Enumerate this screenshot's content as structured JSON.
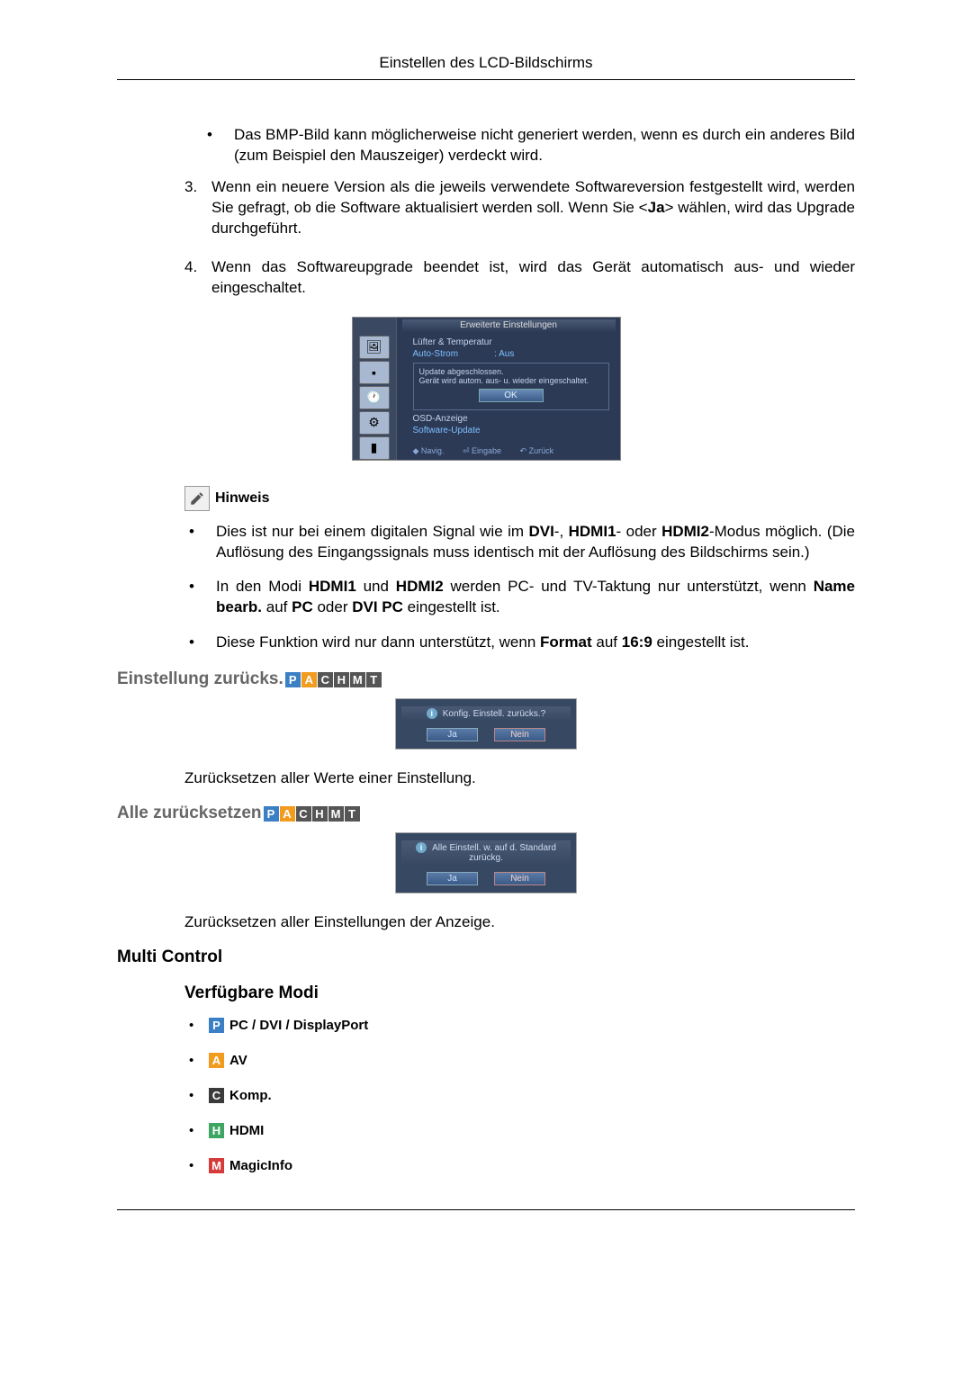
{
  "header": {
    "title": "Einstellen des LCD-Bildschirms"
  },
  "top_bullets": [
    "Das BMP-Bild kann möglicherweise nicht generiert werden, wenn es durch ein anderes Bild (zum Beispiel den Mauszeiger) verdeckt wird."
  ],
  "numbered": [
    {
      "n": "3.",
      "text_pre": "Wenn ein neuere Version als die jeweils verwendete Softwareversion festgestellt wird, werden Sie gefragt, ob die Software aktualisiert werden soll. Wenn Sie <",
      "bold": "Ja",
      "text_post": "> wählen, wird das Upgrade durchgeführt."
    },
    {
      "n": "4.",
      "text_pre": "Wenn das Softwareupgrade beendet ist, wird das Gerät automatisch aus- und wieder eingeschaltet.",
      "bold": "",
      "text_post": ""
    }
  ],
  "osd": {
    "title": "Erweiterte Einstellungen",
    "row1": "Lüfter & Temperatur",
    "row2_label": "Auto-Strom",
    "row2_value": ": Aus",
    "msg1": "Update abgeschlossen.",
    "msg2": "Gerät wird autom. aus- u. wieder eingeschaltet.",
    "ok": "OK",
    "row3": "OSD-Anzeige",
    "row4": "Software-Update",
    "footer_nav": "◆ Navig.",
    "footer_enter": "⏎ Eingabe",
    "footer_back": "↶ Zurück"
  },
  "hinweis": {
    "label": "Hinweis",
    "items": [
      {
        "parts": [
          {
            "t": "Dies ist nur bei einem digitalen Signal wie im "
          },
          {
            "b": "DVI"
          },
          {
            "t": "-, "
          },
          {
            "b": "HDMI1"
          },
          {
            "t": "- oder "
          },
          {
            "b": "HDMI2"
          },
          {
            "t": "-Modus möglich. (Die Auflösung des Eingangssignals muss identisch mit der Auflösung des Bildschirms sein.)"
          }
        ]
      },
      {
        "parts": [
          {
            "t": "In den Modi "
          },
          {
            "b": "HDMI1"
          },
          {
            "t": " und "
          },
          {
            "b": "HDMI2"
          },
          {
            "t": " werden PC- und TV-Taktung nur unterstützt, wenn "
          },
          {
            "b": "Name bearb."
          },
          {
            "t": " auf "
          },
          {
            "b": "PC"
          },
          {
            "t": " oder "
          },
          {
            "b": "DVI PC"
          },
          {
            "t": " eingestellt ist."
          }
        ]
      },
      {
        "parts": [
          {
            "t": "Diese Funktion wird nur dann unterstützt, wenn "
          },
          {
            "b": "Format"
          },
          {
            "t": " auf "
          },
          {
            "b": "16:9"
          },
          {
            "t": " eingestellt ist."
          }
        ]
      }
    ]
  },
  "sec_einstell": {
    "heading": "Einstellung zurücks.",
    "badges": [
      "P",
      "A",
      "C",
      "H",
      "M",
      "T"
    ],
    "dialog_msg": "Konfig. Einstell. zurücks.?",
    "ja": "Ja",
    "nein": "Nein",
    "desc": "Zurücksetzen aller Werte einer Einstellung."
  },
  "sec_alle": {
    "heading": "Alle zurücksetzen",
    "badges": [
      "P",
      "A",
      "C",
      "H",
      "M",
      "T"
    ],
    "dialog_msg": "Alle Einstell. w. auf d. Standard zurückg.",
    "ja": "Ja",
    "nein": "Nein",
    "desc": "Zurücksetzen aller Einstellungen der Anzeige."
  },
  "multi": {
    "heading": "Multi Control",
    "sub": "Verfügbare Modi",
    "modes": [
      {
        "badge": "P",
        "cls": "p",
        "label": "PC / DVI / DisplayPort"
      },
      {
        "badge": "A",
        "cls": "a",
        "label": "AV"
      },
      {
        "badge": "C",
        "cls": "c",
        "label": "Komp."
      },
      {
        "badge": "H",
        "cls": "h",
        "label": "HDMI"
      },
      {
        "badge": "M",
        "cls": "m",
        "label": "MagicInfo"
      }
    ]
  }
}
